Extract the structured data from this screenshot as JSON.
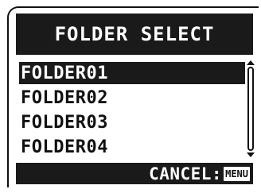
{
  "header": {
    "title": "FOLDER SELECT"
  },
  "list": {
    "items": [
      {
        "label": "FOLDER01",
        "selected": true
      },
      {
        "label": "FOLDER02",
        "selected": false
      },
      {
        "label": "FOLDER03",
        "selected": false
      },
      {
        "label": "FOLDER04",
        "selected": false
      }
    ]
  },
  "footer": {
    "cancel_label": "CANCEL:",
    "menu_key": "MENU"
  },
  "colors": {
    "background": "#ffffff",
    "bar": "#1a1a1a",
    "text_on_bar": "#ffffff",
    "text": "#111111"
  }
}
